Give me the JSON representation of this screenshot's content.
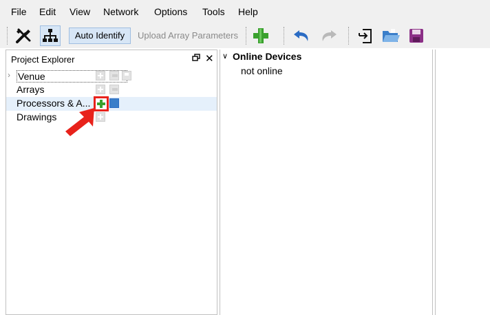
{
  "menu": [
    "File",
    "Edit",
    "View",
    "Network",
    "Options",
    "Tools",
    "Help"
  ],
  "toolbar": {
    "auto_identify": "Auto Identify",
    "upload_array_parameters": "Upload Array Parameters",
    "icons": [
      "tools-icon",
      "network-icon",
      "add-icon",
      "undo-icon",
      "redo-icon",
      "import-icon",
      "open-folder-icon",
      "save-icon"
    ]
  },
  "project_explorer": {
    "title": "Project Explorer",
    "items": [
      {
        "label": "Venue"
      },
      {
        "label": "Arrays"
      },
      {
        "label": "Processors & A..."
      },
      {
        "label": "Drawings"
      }
    ]
  },
  "online_devices": {
    "header": "Online Devices",
    "status": "not online"
  },
  "colors": {
    "accent_green": "#3aa12e",
    "highlight_red": "#e8221b",
    "selected_row": "#e5f0fb"
  }
}
